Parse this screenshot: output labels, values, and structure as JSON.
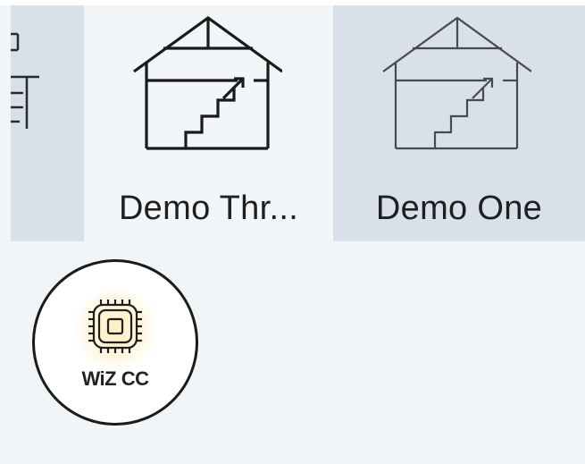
{
  "tiles": [
    {
      "label": "",
      "icon": "partial-house-icon",
      "selected": false
    },
    {
      "label": "Demo Thr...",
      "icon": "house-stairs-icon",
      "selected": true
    },
    {
      "label": "Demo One",
      "icon": "house-stairs-icon",
      "selected": false
    }
  ],
  "wiz_button": {
    "label": "WiZ CC",
    "icon": "chip-icon"
  },
  "colors": {
    "background": "#f2f5f7",
    "tile_unselected": "#d8e1e9",
    "tile_selected": "#f3f6f8",
    "text": "#1f1f1f",
    "glow": "#fff0c2"
  }
}
